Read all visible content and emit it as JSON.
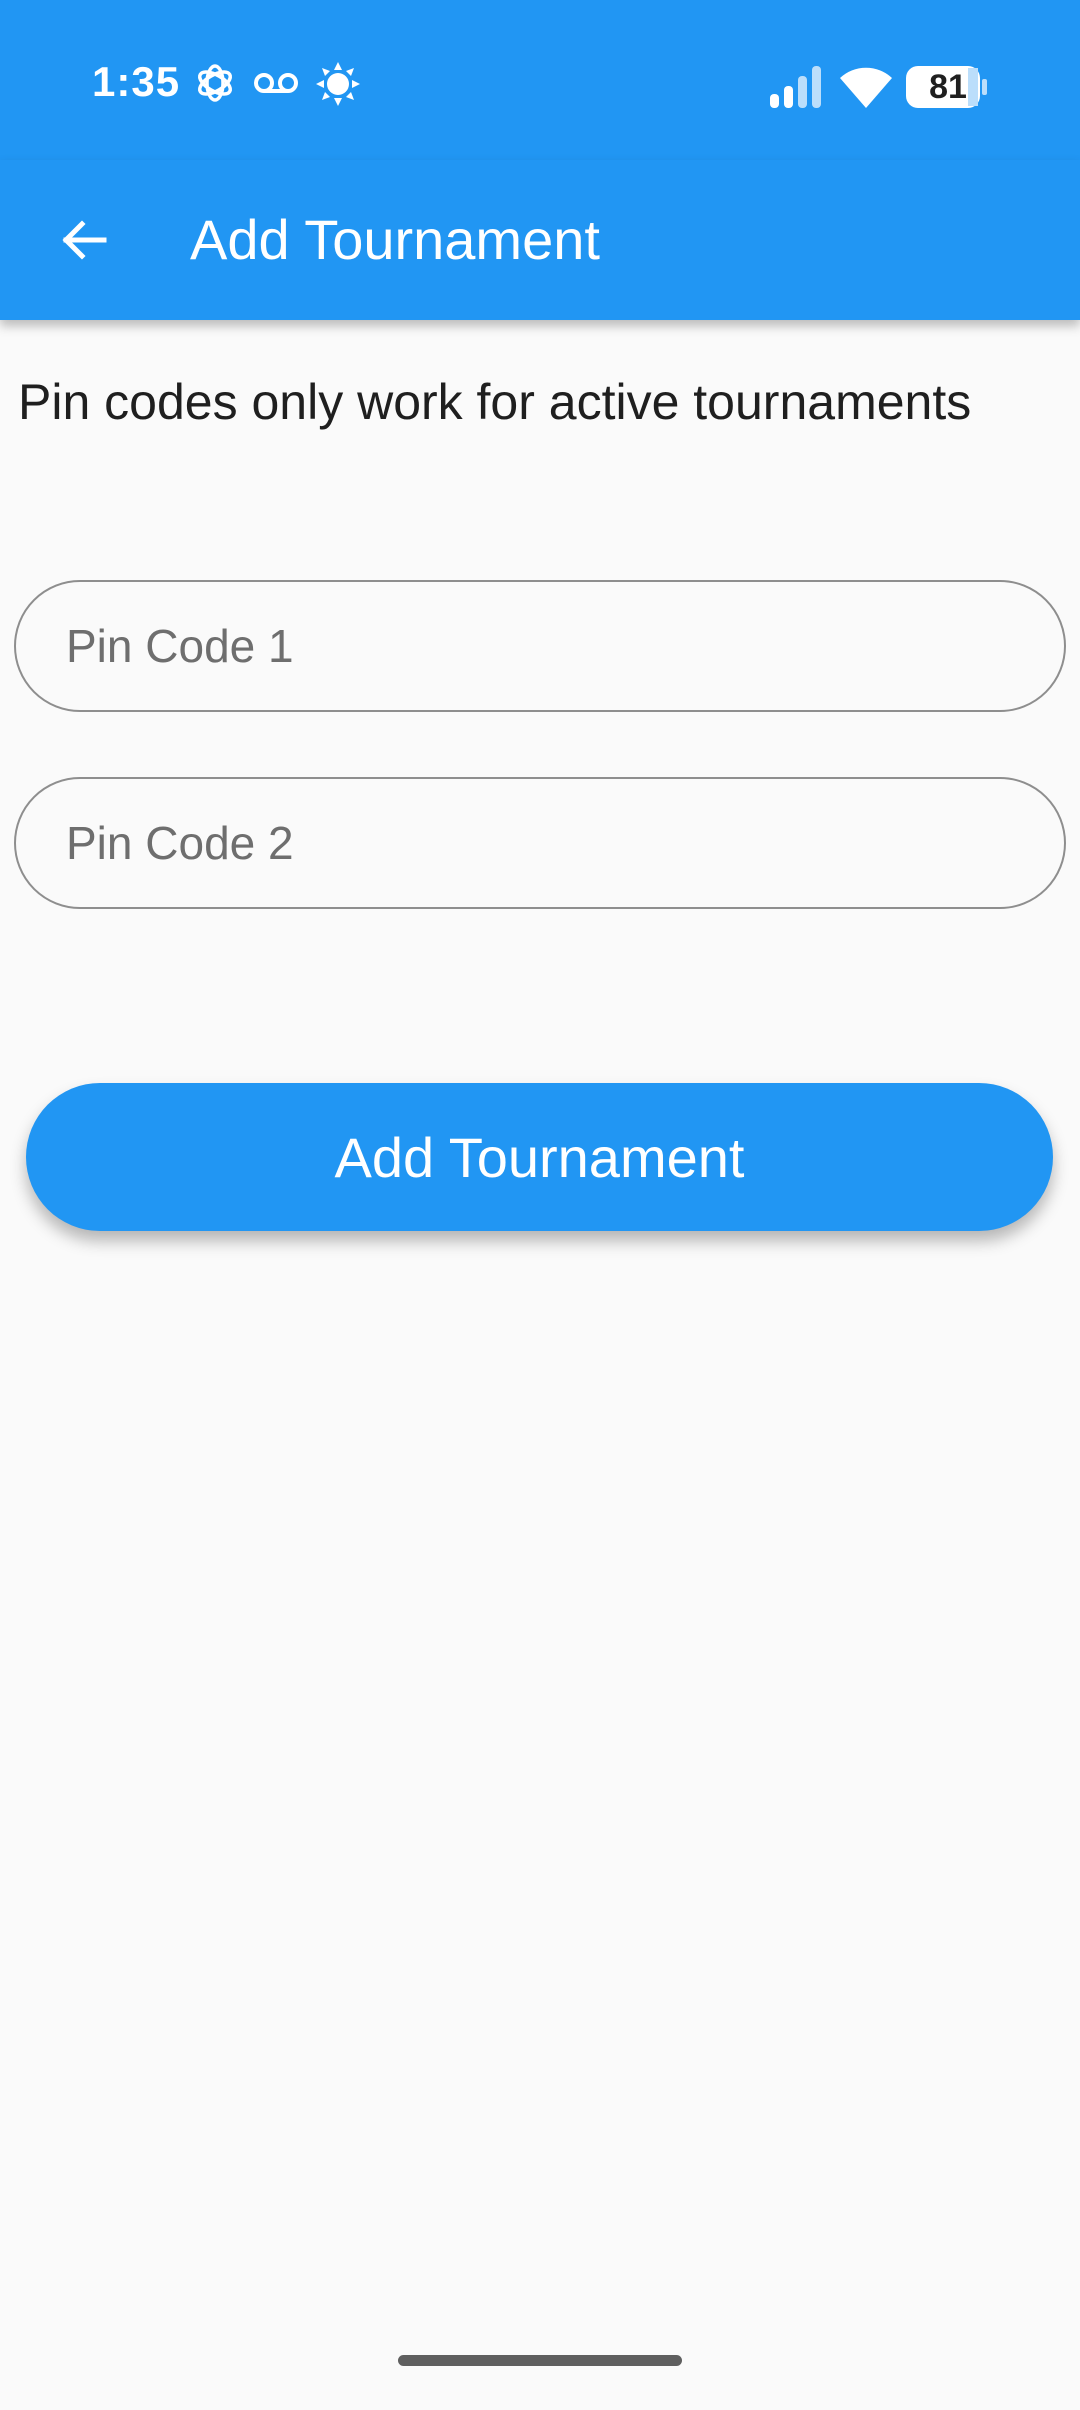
{
  "status_bar": {
    "time": "1:35",
    "battery_level": "81",
    "icons": [
      "openai-icon",
      "voicemail-icon",
      "brightness-icon",
      "signal-icon",
      "wifi-icon",
      "battery-icon"
    ]
  },
  "app_bar": {
    "title": "Add Tournament",
    "back_icon": "arrow-left-icon"
  },
  "form": {
    "info_text": "Pin codes only work for active tournaments",
    "pin_code_1": {
      "placeholder": "Pin Code 1",
      "value": ""
    },
    "pin_code_2": {
      "placeholder": "Pin Code 2",
      "value": ""
    },
    "submit_label": "Add Tournament"
  },
  "colors": {
    "primary": "#2196F3",
    "background": "#FAFAFA",
    "input_border": "#8E8E8E",
    "text": "#1F1F1F"
  }
}
